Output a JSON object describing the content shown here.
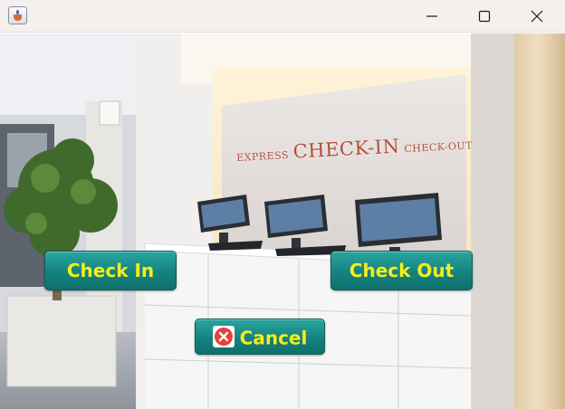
{
  "window": {
    "icon": "java-cup-icon",
    "controls": [
      "minimize-icon",
      "maximize-icon",
      "close-icon"
    ]
  },
  "scene": {
    "sign_prefix": "EXPRESS",
    "sign_main": "CHECK-IN",
    "sign_suffix": "CHECK-OUT"
  },
  "buttons": {
    "check_in": "Check In",
    "check_out": "Check Out",
    "cancel": "Cancel",
    "cancel_icon": "cancel-x-icon"
  },
  "colors": {
    "button_bg": "#15837f",
    "button_text": "#f6ee1a",
    "cancel_icon": "#e5413a"
  }
}
